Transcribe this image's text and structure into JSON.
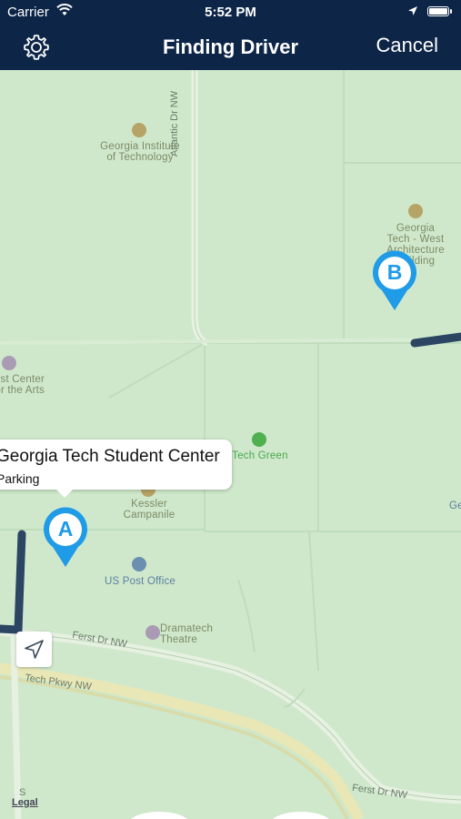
{
  "status_bar": {
    "carrier": "Carrier",
    "time": "5:52 PM"
  },
  "nav": {
    "title": "Finding Driver",
    "cancel_label": "Cancel",
    "settings_icon": "gear-icon"
  },
  "map": {
    "pois": {
      "georgia_tech": "Georgia Institute of Technology",
      "west_arch_line1": "Georgia",
      "west_arch_line2": "Tech - West",
      "west_arch_line3": "Architecture",
      "west_arch_line4": "Building",
      "arts_line1": "Ferst Center",
      "arts_line2": "for the Arts",
      "tech_green": "Tech Green",
      "kessler_line1": "Kessler",
      "kessler_line2": "Campanile",
      "post_office": "US Post Office",
      "dramatech_line1": "Dramatech",
      "dramatech_line2": "Theatre",
      "right_edge_partial": "Ge"
    },
    "roads": {
      "atlantic": "Atlantic Dr NW",
      "ferst_upper": "Ferst Dr NW",
      "tech_pkwy": "Tech Pkwy NW",
      "ferst_lower": "Ferst Dr NW",
      "left_partial": "S"
    },
    "callout": {
      "title": "Georgia Tech Student Center",
      "subtitle": "Parking"
    },
    "pin_a": "A",
    "pin_b": "B",
    "legal": "Legal",
    "colors": {
      "pin": "#1f9be8",
      "route": "#2b4563",
      "header": "#0d2547"
    }
  }
}
